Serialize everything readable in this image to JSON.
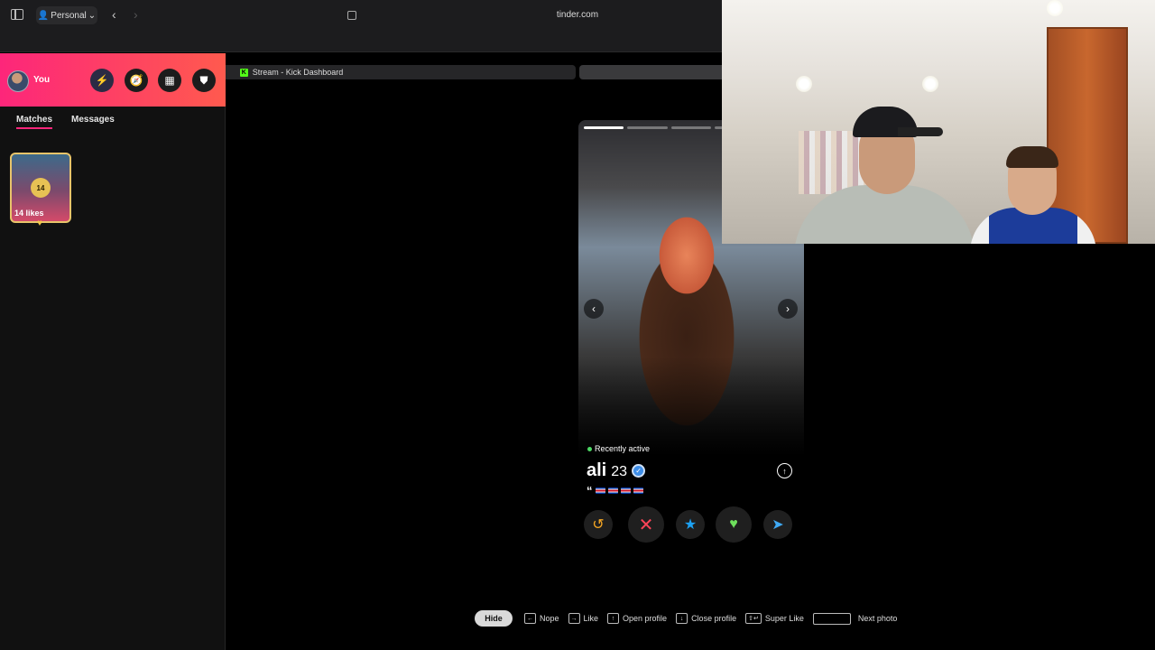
{
  "browser": {
    "profile_label": "Personal",
    "url": "tinder.com",
    "tab_title": "Stream - Kick Dashboard",
    "tab_favicon": "K"
  },
  "sidebar": {
    "user_label": "You",
    "header_icons": [
      "boost-icon",
      "explore-icon",
      "briefcase-icon",
      "shield-icon"
    ],
    "tabs": [
      {
        "label": "Matches",
        "active": true
      },
      {
        "label": "Messages",
        "active": false
      }
    ],
    "likes": {
      "count": "14",
      "label": "14 likes"
    }
  },
  "card": {
    "photo_count": 5,
    "current_photo": 1,
    "status": "Recently active",
    "name": "ali",
    "age": "23",
    "verified": true,
    "bio_quote": "“",
    "actions": [
      "rewind",
      "nope",
      "super-like",
      "like",
      "boost"
    ]
  },
  "hints": {
    "hide_label": "Hide",
    "items": [
      {
        "key": "←",
        "label": "Nope"
      },
      {
        "key": "→",
        "label": "Like"
      },
      {
        "key": "↑",
        "label": "Open profile"
      },
      {
        "key": "↓",
        "label": "Close profile"
      },
      {
        "key": "⇧↵",
        "label": "Super Like"
      },
      {
        "key": "",
        "label": "Next photo"
      }
    ]
  },
  "colors": {
    "brand_gradient_start": "#fd267a",
    "brand_gradient_end": "#ff5a4e",
    "nope": "#ff4458",
    "like": "#6ee05c",
    "superlike": "#1da1f2",
    "rewind": "#f5a623"
  }
}
